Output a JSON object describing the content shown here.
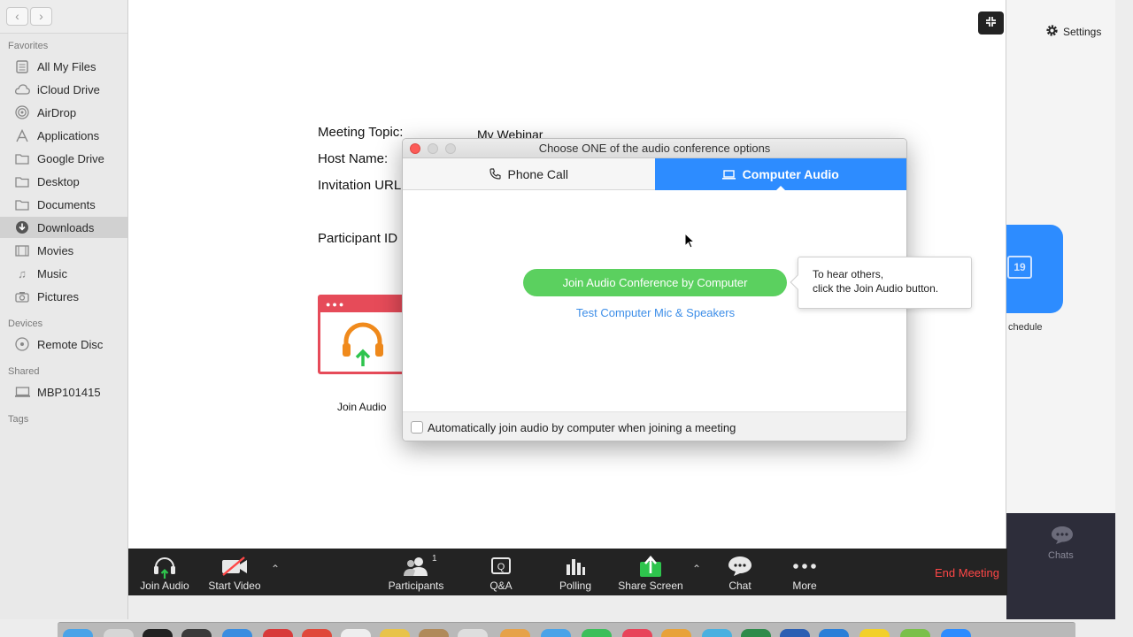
{
  "finder": {
    "favorites_header": "Favorites",
    "favorites": [
      {
        "label": "All My Files",
        "icon": "all-files-icon"
      },
      {
        "label": "iCloud Drive",
        "icon": "cloud-icon"
      },
      {
        "label": "AirDrop",
        "icon": "airdrop-icon"
      },
      {
        "label": "Applications",
        "icon": "applications-icon"
      },
      {
        "label": "Google Drive",
        "icon": "folder-icon"
      },
      {
        "label": "Desktop",
        "icon": "folder-icon"
      },
      {
        "label": "Documents",
        "icon": "folder-icon"
      },
      {
        "label": "Downloads",
        "icon": "downloads-icon",
        "selected": true
      },
      {
        "label": "Movies",
        "icon": "movies-icon"
      },
      {
        "label": "Music",
        "icon": "music-icon"
      },
      {
        "label": "Pictures",
        "icon": "camera-icon"
      }
    ],
    "devices_header": "Devices",
    "devices": [
      {
        "label": "Remote Disc",
        "icon": "disc-icon"
      }
    ],
    "shared_header": "Shared",
    "shared": [
      {
        "label": "MBP101415",
        "icon": "computer-icon"
      }
    ],
    "tags_header": "Tags"
  },
  "meeting": {
    "topic_label": "Meeting Topic:",
    "topic_value": "My Webinar",
    "host_label": "Host Name:",
    "url_label": "Invitation URL",
    "participant_label": "Participant ID",
    "join_audio_label": "Join Audio"
  },
  "dialog": {
    "title": "Choose ONE of the audio conference options",
    "tab_phone": "Phone Call",
    "tab_computer": "Computer Audio",
    "join_button": "Join Audio Conference by Computer",
    "test_link": "Test Computer Mic & Speakers",
    "auto_join_label": "Automatically join audio by computer when joining a meeting",
    "auto_join_checked": false
  },
  "tooltip": {
    "line1": "To hear others,",
    "line2": "click the Join Audio button."
  },
  "toolbar": {
    "join_audio": "Join Audio",
    "start_video": "Start Video",
    "participants": "Participants",
    "participants_count": "1",
    "qa": "Q&A",
    "polling": "Polling",
    "share_screen": "Share Screen",
    "chat": "Chat",
    "more": "More",
    "end_meeting": "End Meeting"
  },
  "right_app": {
    "settings": "Settings",
    "schedule_label": "chedule",
    "chats_label": "Chats",
    "calendar_number": "19"
  },
  "colors": {
    "zoom_blue": "#2d8cff",
    "join_green": "#5bd05f",
    "end_red": "#ff4747",
    "toolbar_bg": "#232323"
  }
}
